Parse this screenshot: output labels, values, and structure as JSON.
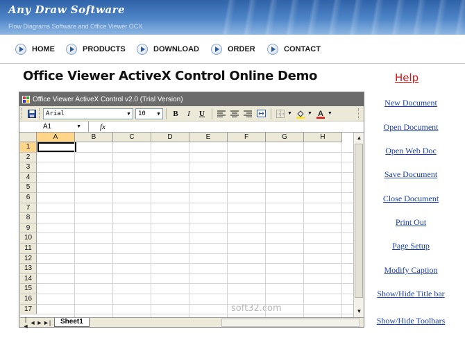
{
  "header": {
    "brand": "Any Draw Software",
    "tagline": "Flow Diagrams Software and Office Viewer OCX"
  },
  "nav": {
    "items": [
      {
        "label": "HOME"
      },
      {
        "label": "PRODUCTS"
      },
      {
        "label": "DOWNLOAD"
      },
      {
        "label": "ORDER"
      },
      {
        "label": "CONTACT"
      }
    ]
  },
  "page": {
    "title": "Office Viewer ActiveX Control Online Demo"
  },
  "sidebar": {
    "help": "Help",
    "links": [
      {
        "label": "New Document"
      },
      {
        "label": "Open Document"
      },
      {
        "label": "Open Web Doc"
      },
      {
        "label": "Save Document"
      },
      {
        "label": "Close Document"
      },
      {
        "label": "Print Out"
      },
      {
        "label": "Page Setup"
      },
      {
        "label": "Modify Caption"
      },
      {
        "label": "Show/Hide Title bar"
      },
      {
        "label": "Show/Hide Toolbars"
      }
    ]
  },
  "control": {
    "window_title": "Office Viewer ActiveX Control v2.0 (Trial Version)",
    "font_name": "Arial",
    "font_size": "10",
    "bold": "B",
    "italic": "I",
    "underline": "U",
    "cell_ref": "A1",
    "fx": "fx",
    "columns": [
      "A",
      "B",
      "C",
      "D",
      "E",
      "F",
      "G",
      "H"
    ],
    "rows": [
      "1",
      "2",
      "3",
      "4",
      "5",
      "6",
      "7",
      "8",
      "9",
      "10",
      "11",
      "12",
      "13",
      "14",
      "15",
      "16",
      "17"
    ],
    "sheet_tab": "Sheet1",
    "watermark": "soft32.com",
    "accent": "#1a3ea8",
    "help_color": "#dd1111"
  }
}
